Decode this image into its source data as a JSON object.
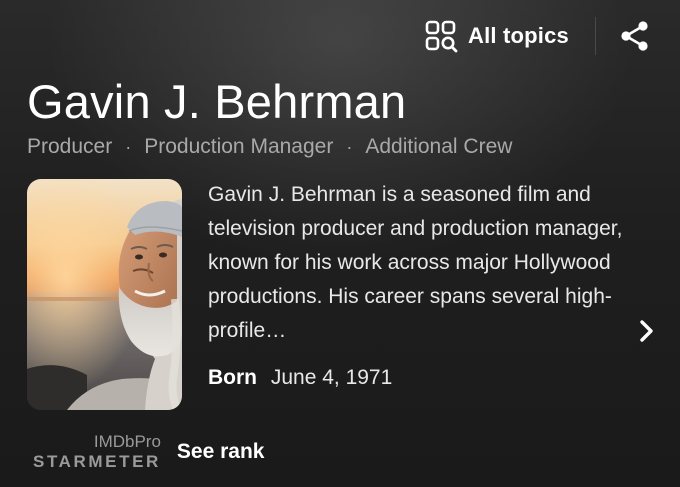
{
  "header": {
    "all_topics_label": "All topics",
    "all_topics_icon": "grid-search-icon",
    "share_icon": "share-icon"
  },
  "person": {
    "name": "Gavin J. Behrman",
    "roles": [
      "Producer",
      "Production Manager",
      "Additional Crew"
    ],
    "bio": "Gavin J. Behrman is a seasoned film and television producer and production manager, known for his work across major Hollywood productions. His career spans several high-profile…",
    "born_label": "Born",
    "born_value": "June 4, 1971"
  },
  "starmeter": {
    "pro_label": "IMDbPro",
    "meter_label": "STARMETER",
    "see_rank_label": "See rank"
  },
  "colors": {
    "background": "#1f1f1f",
    "text_primary": "#ffffff",
    "text_secondary": "#a9a9a9"
  }
}
